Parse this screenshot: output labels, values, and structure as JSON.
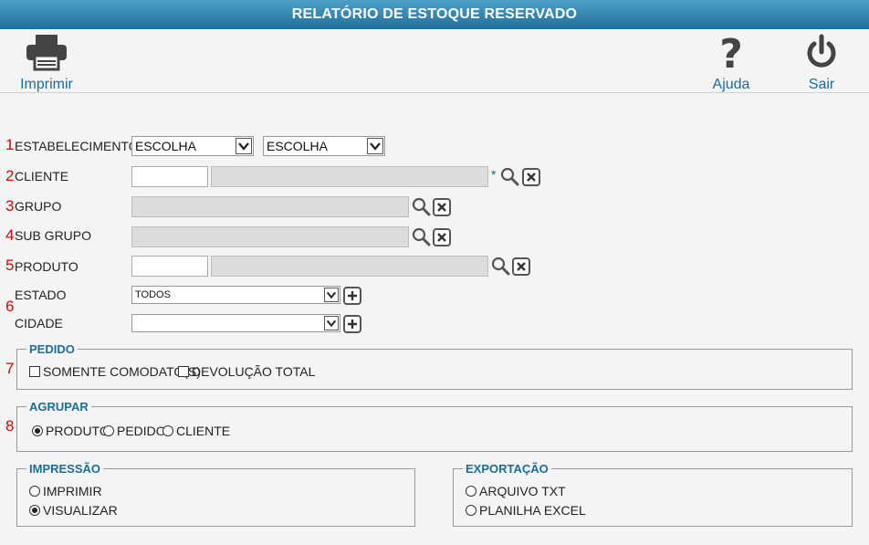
{
  "title": "RELATÓRIO DE ESTOQUE RESERVADO",
  "toolbar": {
    "print": "Imprimir",
    "help": "Ajuda",
    "exit": "Sair"
  },
  "row_numbers": [
    "1",
    "2",
    "3",
    "4",
    "5",
    "6",
    "7",
    "8"
  ],
  "fields": {
    "estabelecimento": {
      "label": "ESTABELECIMENTO",
      "select1": "ESCOLHA",
      "select2": "ESCOLHA"
    },
    "cliente": {
      "label": "CLIENTE",
      "required_mark": "*"
    },
    "grupo": {
      "label": "GRUPO"
    },
    "subgrupo": {
      "label": "SUB GRUPO"
    },
    "produto": {
      "label": "PRODUTO"
    },
    "estado": {
      "label": "ESTADO",
      "value": "TODOS"
    },
    "cidade": {
      "label": "CIDADE",
      "value": ""
    }
  },
  "pedido": {
    "legend": "PEDIDO",
    "options": [
      {
        "label": "SOMENTE COMODATO(S)",
        "checked": false
      },
      {
        "label": "DEVOLUÇÃO TOTAL",
        "checked": false
      }
    ]
  },
  "agrupar": {
    "legend": "AGRUPAR",
    "options": [
      {
        "label": "PRODUTO",
        "selected": true
      },
      {
        "label": "PEDIDO",
        "selected": false
      },
      {
        "label": "CLIENTE",
        "selected": false
      }
    ]
  },
  "impressao": {
    "legend": "IMPRESSÃO",
    "options": [
      {
        "label": "IMPRIMIR",
        "selected": false
      },
      {
        "label": "VISUALIZAR",
        "selected": true
      }
    ]
  },
  "exportacao": {
    "legend": "EXPORTAÇÃO",
    "options": [
      {
        "label": "ARQUIVO TXT",
        "selected": false
      },
      {
        "label": "PLANILHA EXCEL",
        "selected": false
      }
    ]
  },
  "colors": {
    "title_bar": "#2f84b0",
    "accent": "#1c6d97",
    "row_number": "#dd0000",
    "background": "#f4f4f4"
  }
}
